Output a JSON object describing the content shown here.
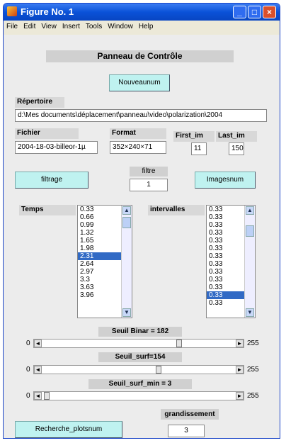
{
  "window": {
    "title": "Figure No. 1",
    "min": "_",
    "max": "□",
    "close": "×"
  },
  "menu": [
    "File",
    "Edit",
    "View",
    "Insert",
    "Tools",
    "Window",
    "Help"
  ],
  "panel_title": "Panneau de Contrôle",
  "nouveau_button": "Nouveaunum",
  "repertoire": {
    "label": "Répertoire",
    "value": "d:\\Mes documents\\déplacement\\panneau\\video\\polarization\\2004"
  },
  "fichier": {
    "label": "Fichier",
    "value": "2004-18-03-billeor-1µ"
  },
  "format": {
    "label": "Format",
    "value": "352×240×71"
  },
  "first_im": {
    "label": "First_im",
    "value": "11"
  },
  "last_im": {
    "label": "Last_im",
    "value": "150"
  },
  "filtrage_button": "filtrage",
  "filtre": {
    "label": "filtre",
    "value": "1"
  },
  "imagesnum_button": "Imagesnum",
  "temps": {
    "label": "Temps",
    "items": [
      "0.33",
      "0.66",
      "0.99",
      "1.32",
      "1.65",
      "1.98",
      "2.31",
      "2.64",
      "2.97",
      "3.3",
      "3.63",
      "3.96"
    ],
    "selected_index": 6
  },
  "intervalles": {
    "label": "intervalles",
    "items": [
      "0.33",
      "0.33",
      "0.33",
      "0.33",
      "0.33",
      "0.33",
      "0.33",
      "0.33",
      "0.33",
      "0.33",
      "0.33",
      "0.33",
      "0.33"
    ],
    "selected_index": 11
  },
  "sliders": [
    {
      "label": "Seuil Binar = 182",
      "min": "0",
      "max": "255",
      "value": 182
    },
    {
      "label": "Seuil_surf=154",
      "min": "0",
      "max": "255",
      "value": 154
    },
    {
      "label": "Seuil_surf_min = 3",
      "min": "0",
      "max": "255",
      "value": 3
    }
  ],
  "grandissement": {
    "label": "grandissement",
    "value": "3"
  },
  "recherche_button": "Recherche_plotsnum"
}
